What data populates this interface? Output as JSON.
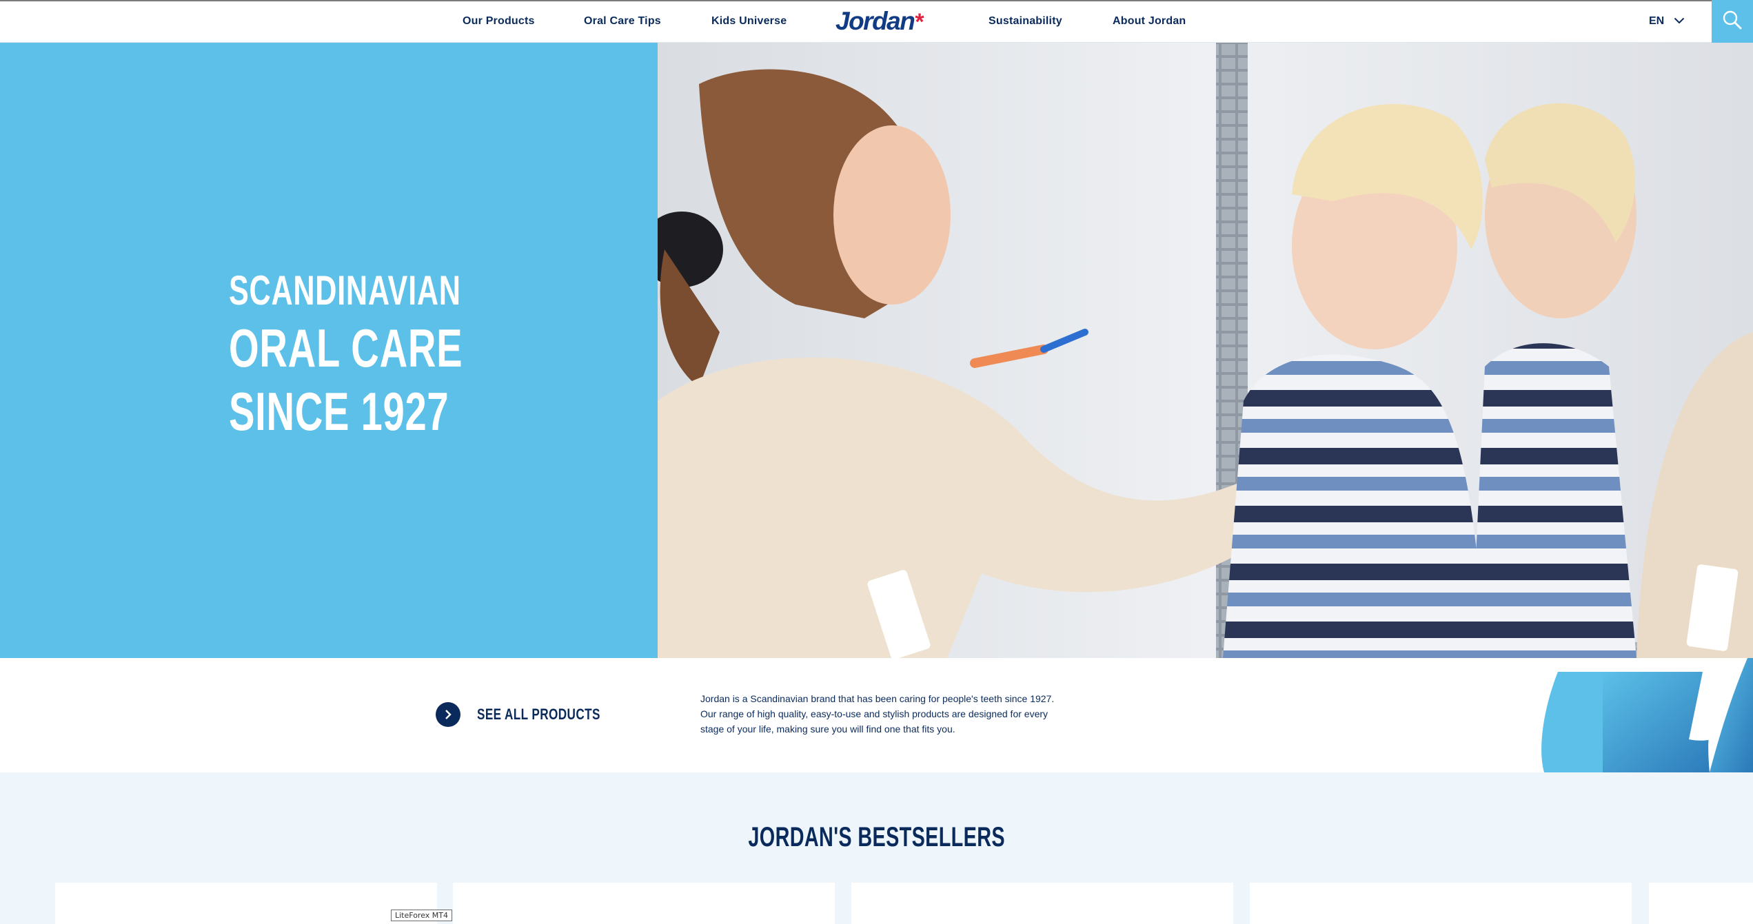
{
  "header": {
    "nav_left": [
      "Our Products",
      "Oral Care Tips",
      "Kids Universe"
    ],
    "logo_text": "Jordan",
    "logo_mark": "*",
    "nav_right": [
      "Sustainability",
      "About Jordan"
    ],
    "language": "EN",
    "icons": {
      "language_toggle": "chevron-down-icon",
      "search": "search-icon"
    }
  },
  "hero": {
    "line1": "SCANDINAVIAN",
    "line2": "ORAL CARE",
    "line3": "SINCE 1927",
    "image": "photo: mother brushing blond boy's teeth in front of a mirror"
  },
  "intro": {
    "see_all_label": "SEE ALL PRODUCTS",
    "description_lines": [
      "Jordan is a Scandinavian brand that has been caring for people's teeth since 1927.",
      "Our range of high quality, easy-to-use and stylish products are designed for every",
      "stage of your life, making sure you will find one that fits you."
    ]
  },
  "bestsellers": {
    "title": "JORDAN'S BESTSELLERS",
    "card_count_visible": 5
  },
  "overlay": {
    "tooltip": "LiteForex MT4"
  },
  "colors": {
    "brand_blue": "#5cc0e8",
    "navy": "#0a2a5c",
    "logo_blue": "#123b86",
    "logo_red": "#e0243f",
    "section_bg": "#eef6fb"
  }
}
